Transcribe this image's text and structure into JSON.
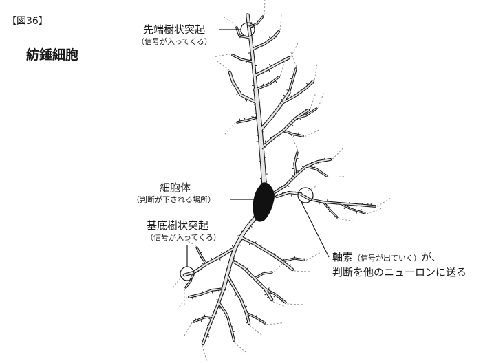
{
  "figure_label": "【図36】",
  "title": "紡錘細胞",
  "labels": {
    "apical": {
      "main": "先端樹状突起",
      "sub": "（信号が入ってくる）"
    },
    "soma": {
      "main": "細胞体",
      "sub": "（判断が下される場所）"
    },
    "basal": {
      "main": "基底樹状突起",
      "sub": "（信号が入ってくる）"
    },
    "axon": {
      "main_prefix": "軸索",
      "sub": "（信号が出ていく）",
      "main_suffix": "が、",
      "line2": "判断を他のニューロンに送る"
    }
  },
  "colors": {
    "line": "#1a1a1a",
    "dendrite_fill": "#e6e6e6",
    "soma": "#111111",
    "dash": "#888888"
  }
}
